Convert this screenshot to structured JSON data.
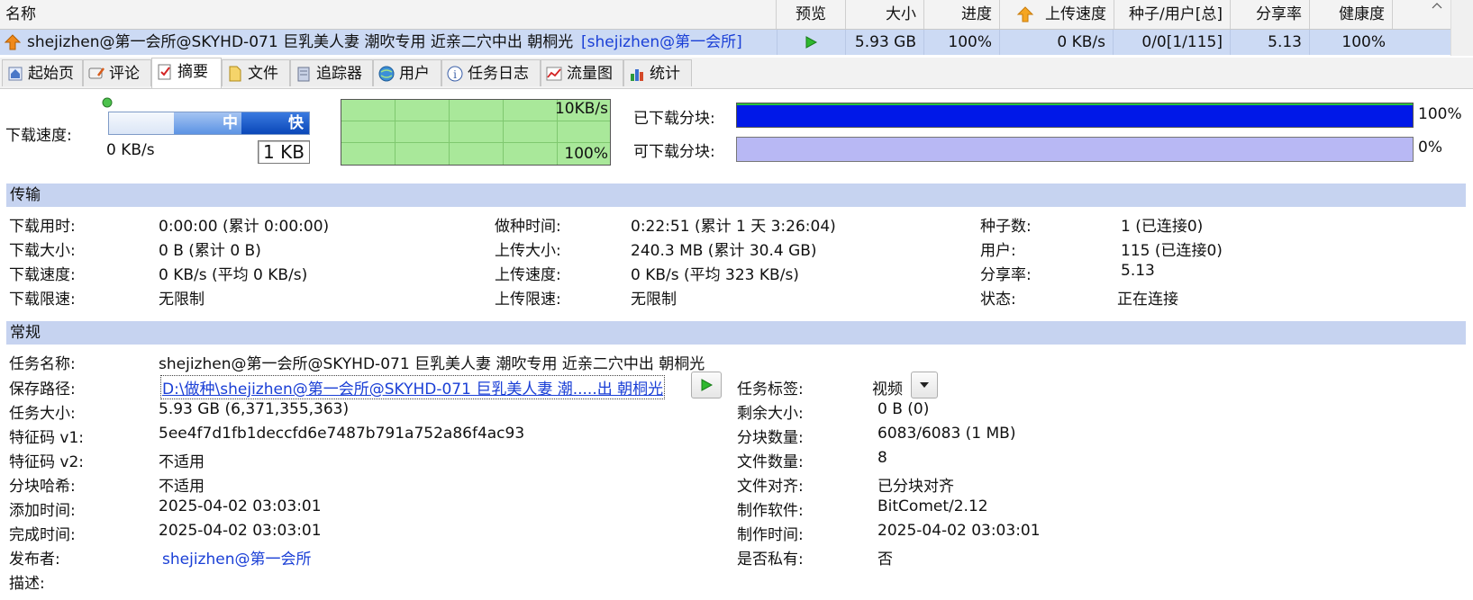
{
  "header": {
    "columns": {
      "name": "名称",
      "preview": "预览",
      "size": "大小",
      "progress": "进度",
      "upload_speed": "上传速度",
      "seeds_users": "种子/用户[总]",
      "share_ratio": "分享率",
      "health": "健康度"
    }
  },
  "task_row": {
    "name": "shejizhen@第一会所@SKYHD-071 巨乳美人妻 潮吹专用 近亲二穴中出 朝桐光",
    "tag": "[shejizhen@第一会所]",
    "size": "5.93 GB",
    "progress": "100%",
    "upload_speed": "0 KB/s",
    "seeds_users": "0/0[1/115]",
    "share_ratio": "5.13",
    "health": "100%"
  },
  "tabs": [
    "起始页",
    "评论",
    "摘要",
    "文件",
    "追踪器",
    "用户",
    "任务日志",
    "流量图",
    "统计"
  ],
  "speed_panel": {
    "download_speed_label": "下载速度:",
    "slider_mid": "中",
    "slider_fast": "快",
    "current_speed": "0 KB/s",
    "limit_value": "1 KB",
    "graph_top_label": "10KB/s",
    "graph_bottom_label": "100%",
    "downloaded_blocks_label": "已下载分块:",
    "downloaded_blocks_pct": "100%",
    "downloaded_fraction": 1.0,
    "available_blocks_label": "可下载分块:",
    "available_blocks_pct": "0%"
  },
  "transfer": {
    "title": "传输",
    "col1": [
      {
        "k": "下载用时:",
        "v": "0:00:00 (累计 0:00:00)"
      },
      {
        "k": "下载大小:",
        "v": "0 B (累计 0 B)"
      },
      {
        "k": "下载速度:",
        "v": "0 KB/s (平均 0 KB/s)"
      },
      {
        "k": "下载限速:",
        "v": "无限制"
      }
    ],
    "col2": [
      {
        "k": "做种时间:",
        "v": "0:22:51 (累计 1 天 3:26:04)"
      },
      {
        "k": "上传大小:",
        "v": "240.3 MB (累计 30.4 GB)"
      },
      {
        "k": "上传速度:",
        "v": "0 KB/s (平均 323 KB/s)"
      },
      {
        "k": "上传限速:",
        "v": "无限制"
      }
    ],
    "col3": [
      {
        "k": "种子数:",
        "v": "1 (已连接0)"
      },
      {
        "k": "用户:",
        "v": "115 (已连接0)"
      },
      {
        "k": "分享率:",
        "v": "5.13"
      },
      {
        "k": "状态:",
        "v": "正在连接"
      }
    ]
  },
  "general": {
    "title": "常规",
    "task_name_k": "任务名称:",
    "task_name_v": "shejizhen@第一会所@SKYHD-071 巨乳美人妻 潮吹专用 近亲二穴中出 朝桐光",
    "save_path_k": "保存路径:",
    "save_path_v": "D:\\做种\\shejizhen@第一会所@SKYHD-071 巨乳美人妻 潮.....出 朝桐光",
    "task_tag_k": "任务标签:",
    "task_tag_v": "视频",
    "left": [
      {
        "k": "任务大小:",
        "v": "5.93 GB (6,371,355,363)"
      },
      {
        "k": "特征码 v1:",
        "v": "5ee4f7d1fb1deccfd6e7487b791a752a86f4ac93"
      },
      {
        "k": "特征码 v2:",
        "v": "不适用"
      },
      {
        "k": "分块哈希:",
        "v": "不适用"
      },
      {
        "k": "添加时间:",
        "v": "2025-04-02 03:03:01"
      },
      {
        "k": "完成时间:",
        "v": "2025-04-02 03:03:01"
      },
      {
        "k": "发布者:",
        "v": "shejizhen@第一会所"
      },
      {
        "k": "描述:",
        "v": ""
      }
    ],
    "right": [
      {
        "k": "剩余大小:",
        "v": "0 B (0)"
      },
      {
        "k": "分块数量:",
        "v": "6083/6083 (1 MB)"
      },
      {
        "k": "文件数量:",
        "v": "8"
      },
      {
        "k": "文件对齐:",
        "v": "已分块对齐"
      },
      {
        "k": "制作软件:",
        "v": "BitComet/2.12"
      },
      {
        "k": "制作时间:",
        "v": "2025-04-02 03:03:01"
      },
      {
        "k": "是否私有:",
        "v": "否"
      }
    ]
  },
  "colors": {
    "selected_row": "#ccdaf4",
    "section_header": "#c6d3f0",
    "downloaded_bar": "#0018e8",
    "available_bar": "#b8b8f4",
    "graph_bg": "#a9e89a",
    "link": "#1a3fd6"
  }
}
